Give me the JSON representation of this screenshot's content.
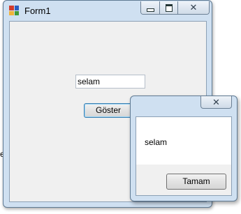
{
  "form": {
    "title": "Form1",
    "textbox_value": "selam",
    "button_label": "Göster",
    "edge_text": "e"
  },
  "messagebox": {
    "message": "selam",
    "ok_label": "Tamam"
  },
  "icons": {
    "app": "windows-forms-app-icon",
    "minimize": "minimize-icon",
    "maximize": "maximize-icon",
    "close": "close-icon"
  },
  "colors": {
    "titlebar": "#cfe0f1",
    "client_bg": "#f0f0f0",
    "focus_border": "#3c7fb1"
  }
}
